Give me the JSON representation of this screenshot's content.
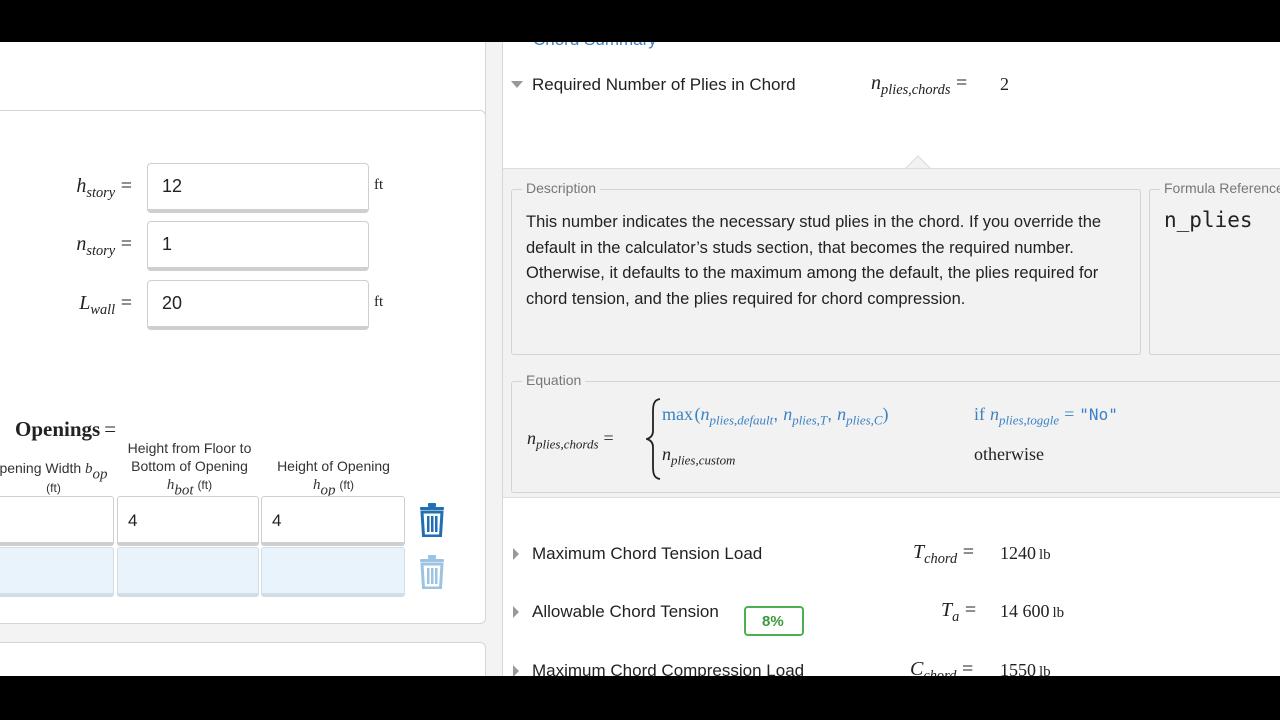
{
  "left": {
    "vars": [
      {
        "sym": "h",
        "sub": "story",
        "value": "12",
        "unit": "ft"
      },
      {
        "sym": "n",
        "sub": "story",
        "value": "1",
        "unit": ""
      },
      {
        "sym": "L",
        "sub": "wall",
        "value": "20",
        "unit": "ft"
      }
    ],
    "eq_sign": "=",
    "openings_label": "Openings",
    "columns": {
      "width": {
        "text": "pening Width",
        "sym": "b",
        "sub": "op",
        "unit": "(ft)"
      },
      "height_floor": {
        "line1": "Height from Floor to",
        "line2": "Bottom of Opening",
        "sym": "h",
        "sub": "bot",
        "unit": "(ft)"
      },
      "height_open": {
        "text": "Height of Opening",
        "sym": "h",
        "sub": "op",
        "unit": "(ft)"
      }
    },
    "rows": [
      {
        "width": "",
        "height_floor": "4",
        "height_open": "4"
      },
      {
        "width": "",
        "height_floor": "",
        "height_open": ""
      }
    ]
  },
  "right": {
    "section_title": "Chord Summary",
    "required_plies": {
      "label": "Required Number of Plies in Chord",
      "sym": "n",
      "sub": "plies,chords",
      "value": "2"
    },
    "description": {
      "legend": "Description",
      "text": "This number indicates the necessary stud plies in the chord. If you override the default in the calculator’s studs section, that becomes the required number. Otherwise, it defaults to the maximum among the default, the plies required for chord tension, and the plies required for chord compression."
    },
    "formula_reference": {
      "legend": "Formula Reference",
      "value": "n_plies"
    },
    "equation": {
      "legend": "Equation",
      "lhs_sym": "n",
      "lhs_sub": "plies,chords",
      "case1_fn": "max",
      "case1_args": [
        {
          "sym": "n",
          "sub": "plies,default"
        },
        {
          "sym": "n",
          "sub": "plies,T"
        },
        {
          "sym": "n",
          "sub": "plies,C"
        }
      ],
      "case1_if": "if",
      "case1_cond_sym": "n",
      "case1_cond_sub": "plies,toggle",
      "case1_cond_val": "\"No\"",
      "case2_sym": "n",
      "case2_sub": "plies,custom",
      "case2_cond": "otherwise"
    },
    "rows": [
      {
        "label": "Maximum Chord Tension Load",
        "sym": "T",
        "sub": "chord",
        "value": "1240",
        "unit": "lb"
      },
      {
        "label": "Allowable Chord Tension",
        "sym": "T",
        "sub": "a",
        "value": "14 600",
        "unit": "lb"
      },
      {
        "label": "Maximum Chord Compression Load",
        "sym": "C",
        "sub": "chord",
        "value": "1550",
        "unit": "lb"
      }
    ],
    "badge": "8%"
  },
  "colors": {
    "accent_blue": "#3b82c4",
    "trash_blue": "#1f6fb2",
    "trash_disabled": "#9cc3e2",
    "badge_green": "#4caf50"
  }
}
